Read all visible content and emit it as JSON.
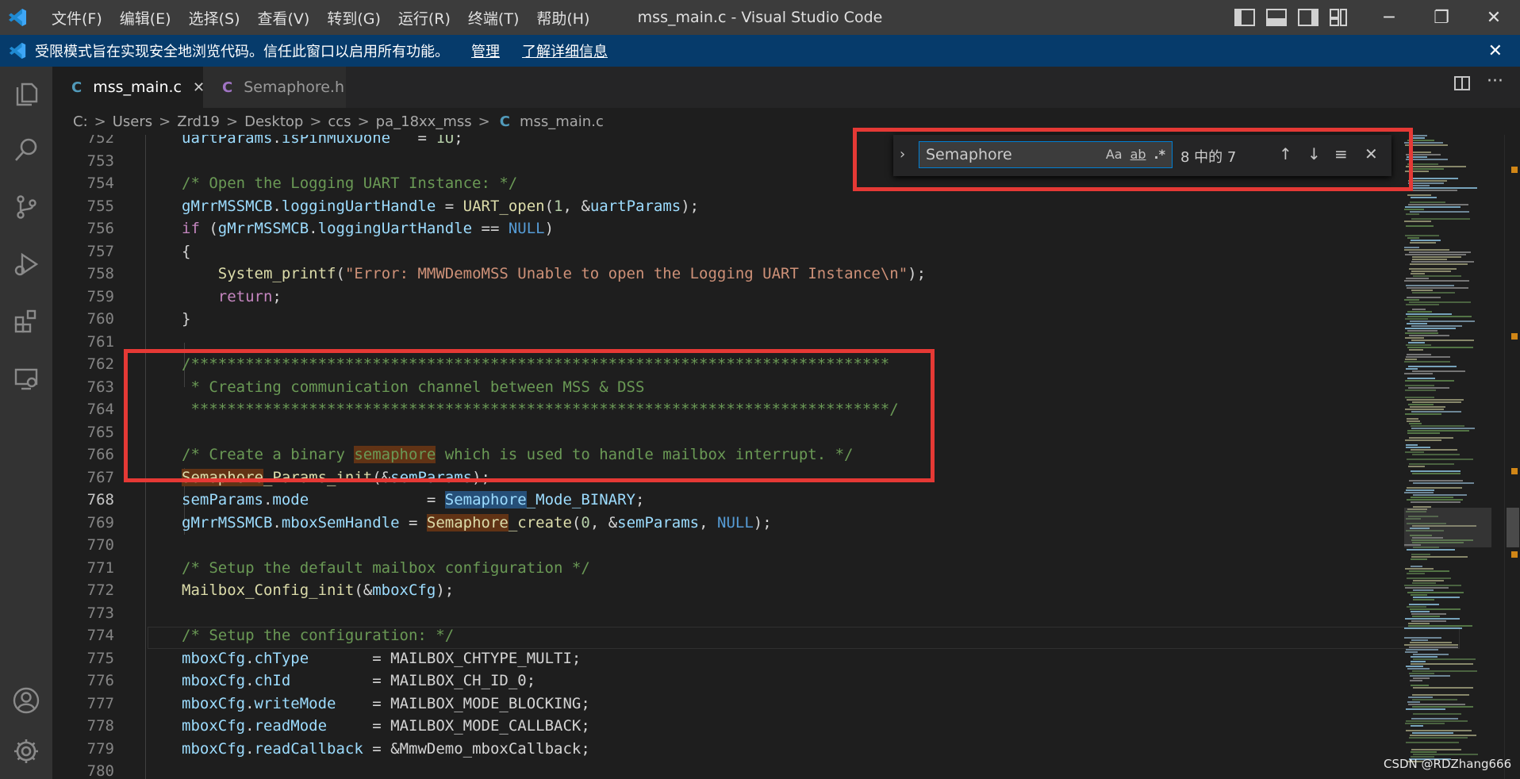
{
  "titlebar": {
    "logo_icon": "vscode-logo-icon",
    "menu": [
      "文件(F)",
      "编辑(E)",
      "选择(S)",
      "查看(V)",
      "转到(G)",
      "运行(R)",
      "终端(T)",
      "帮助(H)"
    ],
    "window_title": "mss_main.c - Visual Studio Code",
    "minimize": "─",
    "maximize": "❐",
    "close": "✕"
  },
  "banner": {
    "text": "受限模式旨在实现安全地浏览代码。信任此窗口以启用所有功能。",
    "manage": "管理",
    "learn_more": "了解详细信息",
    "close": "✕"
  },
  "tabs": [
    {
      "icon_letter": "C",
      "label": "mss_main.c",
      "active": true,
      "close": "✕",
      "icon_color": "#519aba"
    },
    {
      "icon_letter": "C",
      "label": "Semaphore.h",
      "active": false,
      "icon_color": "#a074c4"
    }
  ],
  "tab_actions": {
    "split": "▥",
    "more": "···"
  },
  "breadcrumb": {
    "parts": [
      "C:",
      "Users",
      "Zrd19",
      "Desktop",
      "ccs",
      "pa_18xx_mss"
    ],
    "file_icon": "C",
    "file": "mss_main.c",
    "sep": ">"
  },
  "find": {
    "expand": "›",
    "query": "Semaphore",
    "match_case": "Aa",
    "whole_word": "ab",
    "regex": ".*",
    "count": "8 中的 7",
    "prev": "↑",
    "next": "↓",
    "in_selection": "≡",
    "close": "✕"
  },
  "editor": {
    "current_line": "768",
    "lines": [
      {
        "n": "752",
        "segs": [
          [
            "v",
            "uartParams"
          ],
          [
            "t",
            "."
          ],
          [
            "v",
            "isPinMuxDone"
          ],
          [
            "t",
            "   = "
          ],
          [
            "n",
            "1U"
          ],
          [
            "t",
            ";"
          ]
        ]
      },
      {
        "n": "753",
        "segs": []
      },
      {
        "n": "754",
        "segs": [
          [
            "c",
            "/* Open the Logging UART Instance: */"
          ]
        ]
      },
      {
        "n": "755",
        "segs": [
          [
            "v",
            "gMrrMSSMCB"
          ],
          [
            "t",
            "."
          ],
          [
            "v",
            "loggingUartHandle"
          ],
          [
            "t",
            " = "
          ],
          [
            "f",
            "UART_open"
          ],
          [
            "t",
            "("
          ],
          [
            "n",
            "1"
          ],
          [
            "t",
            ", &"
          ],
          [
            "v",
            "uartParams"
          ],
          [
            "t",
            ");"
          ]
        ]
      },
      {
        "n": "756",
        "segs": [
          [
            "k",
            "if"
          ],
          [
            "t",
            " ("
          ],
          [
            "v",
            "gMrrMSSMCB"
          ],
          [
            "t",
            "."
          ],
          [
            "v",
            "loggingUartHandle"
          ],
          [
            "t",
            " == "
          ],
          [
            "b",
            "NULL"
          ],
          [
            "t",
            ")"
          ]
        ]
      },
      {
        "n": "757",
        "segs": [
          [
            "t",
            "{"
          ]
        ]
      },
      {
        "n": "758",
        "segs": [
          [
            "t",
            "    "
          ],
          [
            "f",
            "System_printf"
          ],
          [
            "t",
            "("
          ],
          [
            "s",
            "\"Error: MMWDemoMSS Unable to open the Logging UART Instance\\n\""
          ],
          [
            "t",
            ");"
          ]
        ]
      },
      {
        "n": "759",
        "segs": [
          [
            "t",
            "    "
          ],
          [
            "k",
            "return"
          ],
          [
            "t",
            ";"
          ]
        ]
      },
      {
        "n": "760",
        "segs": [
          [
            "t",
            "}"
          ]
        ]
      },
      {
        "n": "761",
        "segs": []
      },
      {
        "n": "762",
        "segs": [
          [
            "c",
            "/*****************************************************************************"
          ]
        ]
      },
      {
        "n": "763",
        "segs": [
          [
            "c",
            " * Creating communication channel between MSS & DSS"
          ]
        ]
      },
      {
        "n": "764",
        "segs": [
          [
            "c",
            " *****************************************************************************/"
          ]
        ]
      },
      {
        "n": "765",
        "segs": []
      },
      {
        "n": "766",
        "segs": [
          [
            "c",
            "/* Create a binary "
          ],
          [
            "cm",
            "semaphore"
          ],
          [
            "c",
            " which is used to handle mailbox interrupt. */"
          ]
        ]
      },
      {
        "n": "767",
        "segs": [
          [
            "fm",
            "Semaphore"
          ],
          [
            "f",
            "_Params_init"
          ],
          [
            "t",
            "(&"
          ],
          [
            "v",
            "semParams"
          ],
          [
            "t",
            ");"
          ]
        ]
      },
      {
        "n": "768",
        "segs": [
          [
            "v",
            "semParams"
          ],
          [
            "t",
            "."
          ],
          [
            "v",
            "mode"
          ],
          [
            "t",
            "             = "
          ],
          [
            "vm2",
            "Semaphore"
          ],
          [
            "v",
            "_Mode_BINARY"
          ],
          [
            "t",
            ";"
          ]
        ]
      },
      {
        "n": "769",
        "segs": [
          [
            "v",
            "gMrrMSSMCB"
          ],
          [
            "t",
            "."
          ],
          [
            "v",
            "mboxSemHandle"
          ],
          [
            "t",
            " = "
          ],
          [
            "fm",
            "Semaphore"
          ],
          [
            "f",
            "_create"
          ],
          [
            "t",
            "("
          ],
          [
            "n",
            "0"
          ],
          [
            "t",
            ", &"
          ],
          [
            "v",
            "semParams"
          ],
          [
            "t",
            ", "
          ],
          [
            "b",
            "NULL"
          ],
          [
            "t",
            ");"
          ]
        ]
      },
      {
        "n": "770",
        "segs": []
      },
      {
        "n": "771",
        "segs": [
          [
            "c",
            "/* Setup the default mailbox configuration */"
          ]
        ]
      },
      {
        "n": "772",
        "segs": [
          [
            "f",
            "Mailbox_Config_init"
          ],
          [
            "t",
            "(&"
          ],
          [
            "v",
            "mboxCfg"
          ],
          [
            "t",
            ");"
          ]
        ]
      },
      {
        "n": "773",
        "segs": []
      },
      {
        "n": "774",
        "segs": [
          [
            "c",
            "/* Setup the configuration: */"
          ]
        ]
      },
      {
        "n": "775",
        "segs": [
          [
            "v",
            "mboxCfg"
          ],
          [
            "t",
            "."
          ],
          [
            "v",
            "chType"
          ],
          [
            "t",
            "       = "
          ],
          [
            "t",
            "MAILBOX_CHTYPE_MULTI"
          ],
          [
            "t",
            ";"
          ]
        ]
      },
      {
        "n": "776",
        "segs": [
          [
            "v",
            "mboxCfg"
          ],
          [
            "t",
            "."
          ],
          [
            "v",
            "chId"
          ],
          [
            "t",
            "         = "
          ],
          [
            "t",
            "MAILBOX_CH_ID_0"
          ],
          [
            "t",
            ";"
          ]
        ]
      },
      {
        "n": "777",
        "segs": [
          [
            "v",
            "mboxCfg"
          ],
          [
            "t",
            "."
          ],
          [
            "v",
            "writeMode"
          ],
          [
            "t",
            "    = "
          ],
          [
            "t",
            "MAILBOX_MODE_BLOCKING"
          ],
          [
            "t",
            ";"
          ]
        ]
      },
      {
        "n": "778",
        "segs": [
          [
            "v",
            "mboxCfg"
          ],
          [
            "t",
            "."
          ],
          [
            "v",
            "readMode"
          ],
          [
            "t",
            "     = "
          ],
          [
            "t",
            "MAILBOX_MODE_CALLBACK"
          ],
          [
            "t",
            ";"
          ]
        ]
      },
      {
        "n": "779",
        "segs": [
          [
            "v",
            "mboxCfg"
          ],
          [
            "t",
            "."
          ],
          [
            "v",
            "readCallback"
          ],
          [
            "t",
            " = &"
          ],
          [
            "t",
            "MmwDemo_mboxCallback"
          ],
          [
            "t",
            ";"
          ]
        ]
      },
      {
        "n": "780",
        "segs": []
      }
    ]
  },
  "colors": {
    "accent_blue": "#007acc",
    "banner_bg": "#063b6b",
    "highlight_box": "#e53935",
    "find_match": "#613315"
  },
  "watermark": "CSDN @RDZhang666"
}
